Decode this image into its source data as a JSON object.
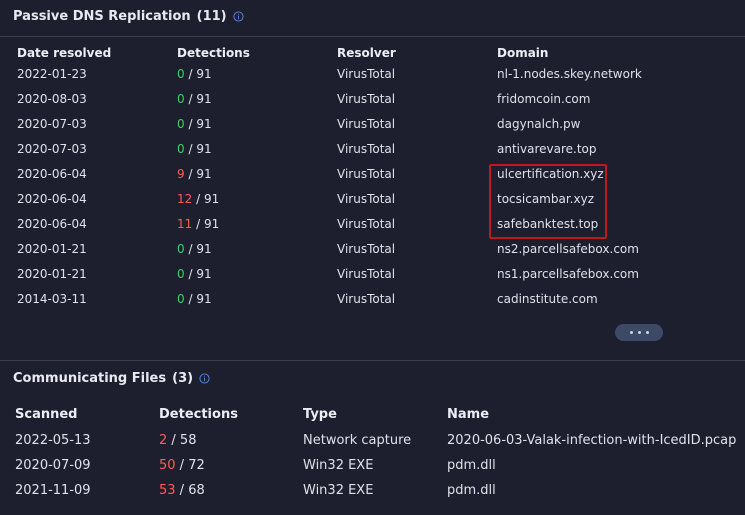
{
  "colors": {
    "background": "#1e1f2e",
    "zero_detections": "#3ecf6e",
    "positive_detections": "#ff5b5b",
    "highlight_box": "#c0191d",
    "info_icon": "#5b86e5"
  },
  "passive_dns": {
    "title": "Passive DNS Replication",
    "count": "(11)",
    "icon": "info-icon",
    "headers": {
      "date": "Date resolved",
      "detections": "Detections",
      "resolver": "Resolver",
      "domain": "Domain"
    },
    "rows": [
      {
        "date": "2022-01-23",
        "det": "0",
        "total": " / 91",
        "resolver": "VirusTotal",
        "domain": "nl-1.nodes.skey.network",
        "flag": "zero"
      },
      {
        "date": "2020-08-03",
        "det": "0",
        "total": " / 91",
        "resolver": "VirusTotal",
        "domain": "fridomcoin.com",
        "flag": "zero"
      },
      {
        "date": "2020-07-03",
        "det": "0",
        "total": " / 91",
        "resolver": "VirusTotal",
        "domain": "dagynalch.pw",
        "flag": "zero"
      },
      {
        "date": "2020-07-03",
        "det": "0",
        "total": " / 91",
        "resolver": "VirusTotal",
        "domain": "antivarevare.top",
        "flag": "zero"
      },
      {
        "date": "2020-06-04",
        "det": "9",
        "total": " / 91",
        "resolver": "VirusTotal",
        "domain": "ulcertification.xyz",
        "flag": "positive"
      },
      {
        "date": "2020-06-04",
        "det": "12",
        "total": " / 91",
        "resolver": "VirusTotal",
        "domain": "tocsicambar.xyz",
        "flag": "positive"
      },
      {
        "date": "2020-06-04",
        "det": "11",
        "total": " / 91",
        "resolver": "VirusTotal",
        "domain": "safebanktest.top",
        "flag": "positive"
      },
      {
        "date": "2020-01-21",
        "det": "0",
        "total": " / 91",
        "resolver": "VirusTotal",
        "domain": "ns2.parcellsafebox.com",
        "flag": "zero"
      },
      {
        "date": "2020-01-21",
        "det": "0",
        "total": " / 91",
        "resolver": "VirusTotal",
        "domain": "ns1.parcellsafebox.com",
        "flag": "zero"
      },
      {
        "date": "2014-03-11",
        "det": "0",
        "total": " / 91",
        "resolver": "VirusTotal",
        "domain": "cadinstitute.com",
        "flag": "zero"
      }
    ],
    "more_icon": "ellipsis-icon"
  },
  "communicating_files": {
    "title": "Communicating Files",
    "count": "(3)",
    "icon": "info-icon",
    "headers": {
      "scanned": "Scanned",
      "detections": "Detections",
      "type": "Type",
      "name": "Name"
    },
    "rows": [
      {
        "scanned": "2022-05-13",
        "det": "2",
        "total": " / 58",
        "type": "Network capture",
        "name": "2020-06-03-Valak-infection-with-IcedID.pcap"
      },
      {
        "scanned": "2020-07-09",
        "det": "50",
        "total": " / 72",
        "type": "Win32 EXE",
        "name": "pdm.dll"
      },
      {
        "scanned": "2021-11-09",
        "det": "53",
        "total": " / 68",
        "type": "Win32 EXE",
        "name": "pdm.dll"
      }
    ]
  }
}
